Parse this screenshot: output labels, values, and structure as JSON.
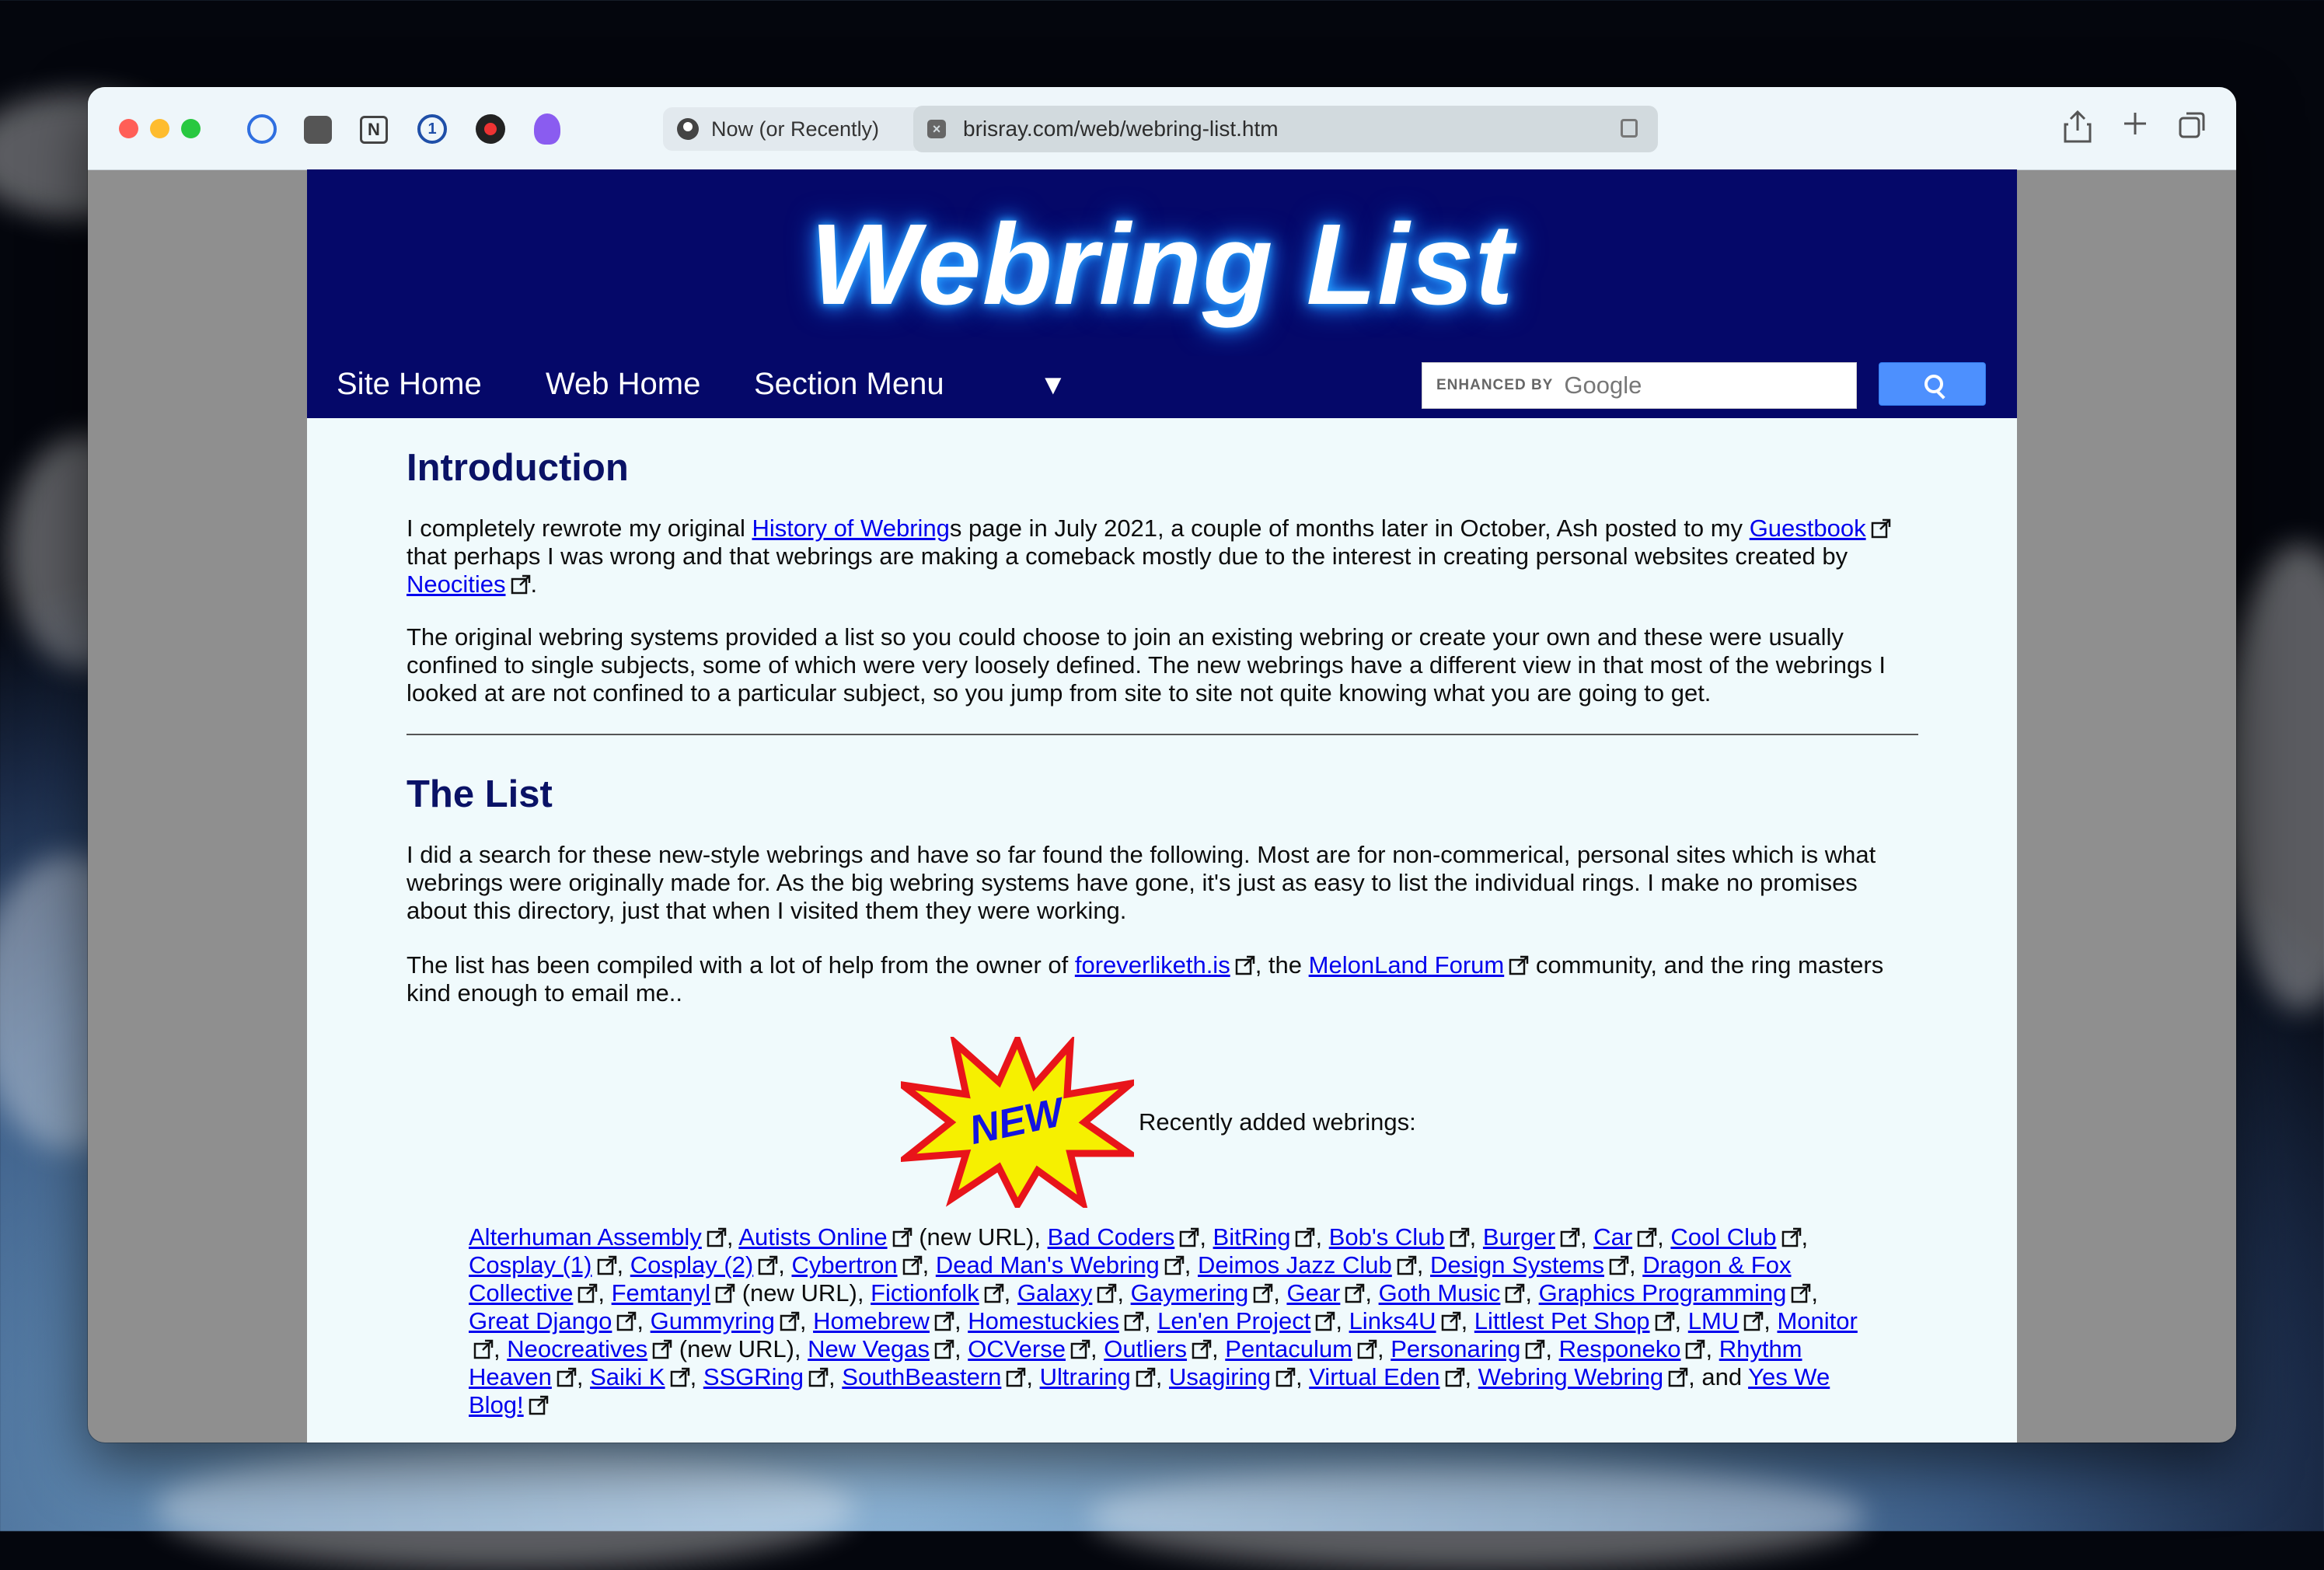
{
  "browser": {
    "tabs": [
      {
        "label": "Now (or Recently)"
      }
    ],
    "address": "brisray.com/web/webring-list.htm",
    "extensions": [
      "clock-extension-icon",
      "pocket-icon",
      "notion-icon",
      "onepassword-icon",
      "bug-extension-icon",
      "crystal-extension-icon"
    ]
  },
  "site": {
    "title": "Webring List",
    "nav": {
      "site_home": "Site Home",
      "web_home": "Web Home",
      "section_menu": "Section Menu",
      "menu_arrow": "▼"
    },
    "search": {
      "enhanced_by": "ENHANCED BY",
      "brand": "Google"
    }
  },
  "intro": {
    "heading": "Introduction",
    "p1": {
      "t1": "I completely rewrote my original ",
      "link1": "History of Webring",
      "t2": "s page in July 2021, a couple of months later in October, Ash posted to my ",
      "link2": "Guestbook",
      "t3": " that perhaps I was wrong and that webrings are making a comeback mostly due to the interest in creating personal websites created by ",
      "link3": "Neocities",
      "t4": "."
    },
    "p2": "The original webring systems provided a list so you could choose to join an existing webring or create your own and these were usually confined to single subjects, some of which were very loosely defined. The new webrings have a different view in that most of the webrings I looked at are not confined to a particular subject, so you jump from site to site not quite knowing what you are going to get."
  },
  "list_section": {
    "heading": "The List",
    "p1": "I did a search for these new-style webrings and have so far found the following. Most are for non-commerical, personal sites which is what webrings were originally made for. As the big webring systems have gone, it's just as easy to list the individual rings. I make no promises about this directory, just that when I visited them they were working.",
    "p2": {
      "t1": "The list has been compiled with a lot of help from the owner of ",
      "link1": "foreverliketh.is",
      "t2": ", the ",
      "link2": "MelonLand Forum",
      "t3": " community, and the ring masters kind enough to email me.."
    },
    "new_badge": "NEW",
    "recently_added_label": "Recently added webrings:",
    "rings": [
      {
        "name": "Alterhuman Assembly"
      },
      {
        "name": "Autists Online",
        "note": "(new URL)"
      },
      {
        "name": "Bad Coders"
      },
      {
        "name": "BitRing"
      },
      {
        "name": "Bob's Club"
      },
      {
        "name": "Burger"
      },
      {
        "name": "Car"
      },
      {
        "name": "Cool Club"
      },
      {
        "name": "Cosplay (1)"
      },
      {
        "name": "Cosplay (2)"
      },
      {
        "name": "Cybertron"
      },
      {
        "name": "Dead Man's Webring"
      },
      {
        "name": "Deimos Jazz Club"
      },
      {
        "name": "Design Systems"
      },
      {
        "name": "Dragon & Fox Collective"
      },
      {
        "name": "Femtanyl",
        "note": "(new URL)"
      },
      {
        "name": "Fictionfolk"
      },
      {
        "name": "Galaxy"
      },
      {
        "name": "Gaymering"
      },
      {
        "name": "Gear"
      },
      {
        "name": "Goth Music"
      },
      {
        "name": "Graphics Programming"
      },
      {
        "name": "Great Django"
      },
      {
        "name": "Gummyring"
      },
      {
        "name": "Homebrew"
      },
      {
        "name": "Homestuckies"
      },
      {
        "name": "Len'en Project"
      },
      {
        "name": "Links4U"
      },
      {
        "name": "Littlest Pet Shop"
      },
      {
        "name": "LMU"
      },
      {
        "name": "Monitor"
      },
      {
        "name": "Neocreatives",
        "note": "(new URL)"
      },
      {
        "name": "New Vegas"
      },
      {
        "name": "OCVerse"
      },
      {
        "name": "Outliers"
      },
      {
        "name": "Pentaculum"
      },
      {
        "name": "Personaring"
      },
      {
        "name": "Responeko"
      },
      {
        "name": "Rhythm Heaven"
      },
      {
        "name": "Saiki K"
      },
      {
        "name": "SSGRing"
      },
      {
        "name": "SouthBeastern"
      },
      {
        "name": "Ultraring"
      },
      {
        "name": "Usagiring"
      },
      {
        "name": "Virtual Eden"
      },
      {
        "name": "Webring Webring"
      },
      {
        "name": "Yes We Blog!"
      }
    ],
    "list_and": ", and "
  }
}
